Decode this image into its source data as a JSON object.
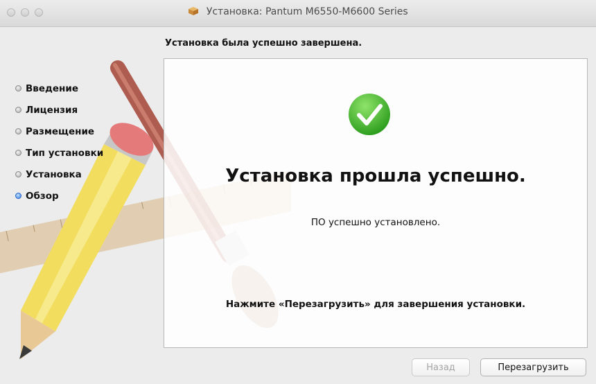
{
  "window": {
    "title": "Установка: Pantum M6550-M6600 Series",
    "title_icon": "package-icon"
  },
  "heading": "Установка была успешно завершена.",
  "sidebar": {
    "steps": [
      {
        "label": "Введение",
        "active": false
      },
      {
        "label": "Лицензия",
        "active": false
      },
      {
        "label": "Размещение",
        "active": false
      },
      {
        "label": "Тип установки",
        "active": false
      },
      {
        "label": "Установка",
        "active": false
      },
      {
        "label": "Обзор",
        "active": true
      }
    ]
  },
  "content": {
    "status_icon": "green-checkmark-icon",
    "title": "Установка прошла успешно.",
    "message": "ПО успешно установлено.",
    "hint": "Нажмите «Перезагрузить» для завершения установки."
  },
  "buttons": {
    "back_label": "Назад",
    "restart_label": "Перезагрузить"
  },
  "colors": {
    "success_green": "#3cbf2e",
    "active_step_blue": "#3a7fe0"
  }
}
